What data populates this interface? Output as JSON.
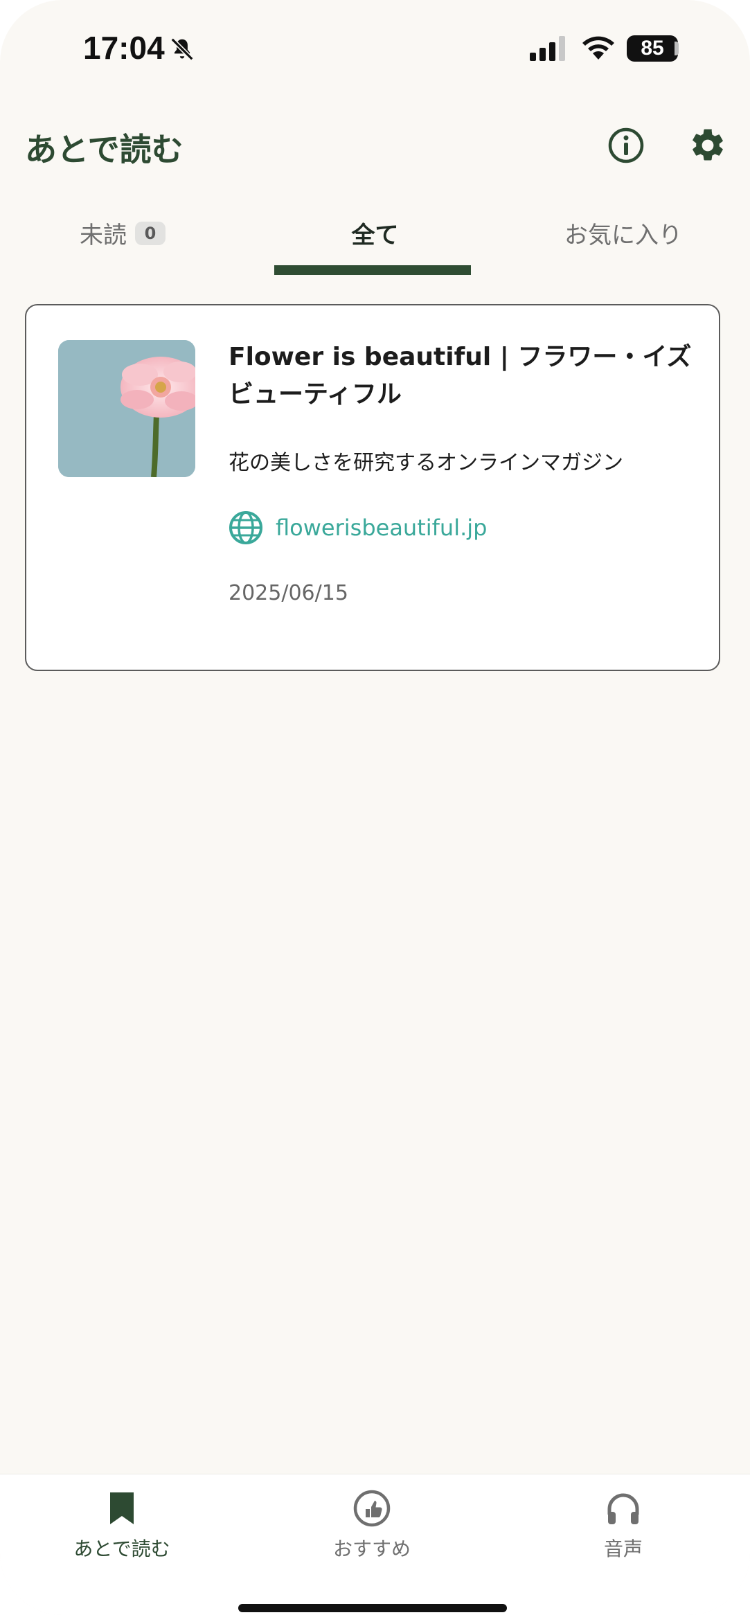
{
  "status_bar": {
    "time": "17:04",
    "battery": "85",
    "icons": [
      "bell-slash-icon",
      "signal-icon",
      "wifi-icon",
      "battery-icon"
    ]
  },
  "header": {
    "title": "あとで読む",
    "icons": [
      "info-icon",
      "gear-icon"
    ]
  },
  "tabs": {
    "items": [
      {
        "label": "未読",
        "badge": "0"
      },
      {
        "label": "全て"
      },
      {
        "label": "お気に入り"
      }
    ],
    "selected": "全て"
  },
  "articles": [
    {
      "title": "Flower is beautiful | フラワー・イズビューティフル",
      "description": "花の美しさを研究するオンラインマガジン",
      "site": "flowerisbeautiful.jp",
      "date": "2025/06/15",
      "thumbnail_icon": "flower-thumbnail"
    }
  ],
  "bottom_nav": {
    "items": [
      {
        "label": "あとで読む",
        "icon": "bookmark-icon"
      },
      {
        "label": "おすすめ",
        "icon": "thumbs-up-icon"
      },
      {
        "label": "音声",
        "icon": "headphones-icon"
      }
    ],
    "selected": "あとで読む"
  },
  "colors": {
    "accent": "#2f4d33",
    "link": "#3aa89a",
    "background": "#faf8f4"
  }
}
